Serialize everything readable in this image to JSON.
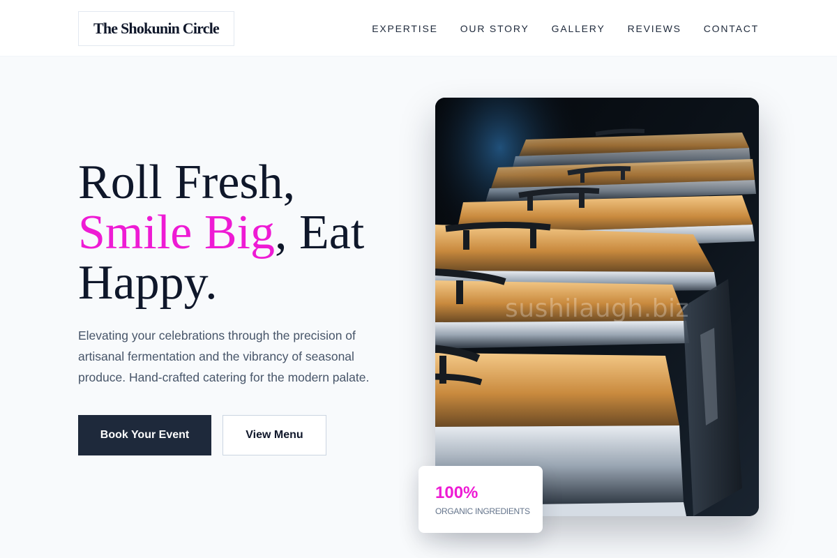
{
  "brand": {
    "name": "The Shokunin Circle"
  },
  "nav": {
    "items": [
      {
        "label": "EXPERTISE"
      },
      {
        "label": "OUR STORY"
      },
      {
        "label": "GALLERY"
      },
      {
        "label": "REVIEWS"
      },
      {
        "label": "CONTACT"
      }
    ]
  },
  "hero": {
    "title_line1": "Roll Fresh,",
    "title_accent": "Smile Big",
    "title_rest": ", Eat",
    "title_line3": "Happy.",
    "description": "Elevating your celebrations through the precision of artisanal fermentation and the vibrancy of seasonal produce. Hand-crafted catering for the modern palate.",
    "primary_button": "Book Your Event",
    "secondary_button": "View Menu"
  },
  "image": {
    "watermark": "sushilaugh.biz",
    "subject": "chafing-dishes"
  },
  "stat": {
    "value": "100%",
    "label": "ORGANIC INGREDIENTS"
  },
  "colors": {
    "accent": "#ee1bd4",
    "dark": "#1e293b",
    "background": "#f8fafc"
  }
}
